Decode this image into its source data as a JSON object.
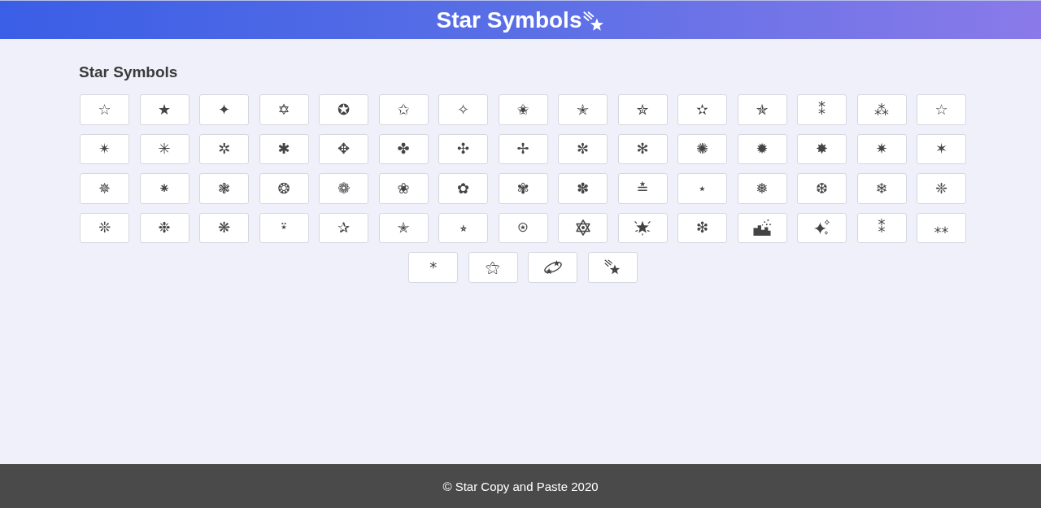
{
  "header": {
    "title": "Star Symbols"
  },
  "section": {
    "heading": "Star Symbols"
  },
  "symbols": [
    {
      "kind": "glyph",
      "text": "☆"
    },
    {
      "kind": "glyph",
      "text": "★"
    },
    {
      "kind": "glyph",
      "text": "✦"
    },
    {
      "kind": "glyph",
      "text": "✡"
    },
    {
      "kind": "glyph",
      "text": "✪"
    },
    {
      "kind": "glyph",
      "text": "✩"
    },
    {
      "kind": "glyph",
      "text": "✧"
    },
    {
      "kind": "glyph",
      "text": "✬"
    },
    {
      "kind": "glyph",
      "text": "✭"
    },
    {
      "kind": "glyph",
      "text": "✮"
    },
    {
      "kind": "glyph",
      "text": "✫"
    },
    {
      "kind": "glyph",
      "text": "✯"
    },
    {
      "kind": "glyph",
      "text": "⁑"
    },
    {
      "kind": "glyph",
      "text": "⁂"
    },
    {
      "kind": "glyph",
      "text": "☆"
    },
    {
      "kind": "glyph",
      "text": "✴"
    },
    {
      "kind": "glyph",
      "text": "✳"
    },
    {
      "kind": "glyph",
      "text": "✲"
    },
    {
      "kind": "glyph",
      "text": "✱"
    },
    {
      "kind": "glyph",
      "text": "✥"
    },
    {
      "kind": "glyph",
      "text": "✤"
    },
    {
      "kind": "glyph",
      "text": "✣"
    },
    {
      "kind": "glyph",
      "text": "✢"
    },
    {
      "kind": "glyph",
      "text": "✼"
    },
    {
      "kind": "glyph",
      "text": "✻"
    },
    {
      "kind": "glyph",
      "text": "✺"
    },
    {
      "kind": "glyph",
      "text": "✹"
    },
    {
      "kind": "glyph",
      "text": "✸"
    },
    {
      "kind": "glyph",
      "text": "✷"
    },
    {
      "kind": "glyph",
      "text": "✶"
    },
    {
      "kind": "glyph",
      "text": "✵"
    },
    {
      "kind": "glyph",
      "text": "⁕"
    },
    {
      "kind": "glyph",
      "text": "❃"
    },
    {
      "kind": "glyph",
      "text": "❂"
    },
    {
      "kind": "glyph",
      "text": "❁"
    },
    {
      "kind": "glyph",
      "text": "❀"
    },
    {
      "kind": "glyph",
      "text": "✿"
    },
    {
      "kind": "glyph",
      "text": "✾"
    },
    {
      "kind": "glyph",
      "text": "✽"
    },
    {
      "kind": "glyph",
      "text": "≛"
    },
    {
      "kind": "glyph",
      "text": "⋆"
    },
    {
      "kind": "glyph",
      "text": "❅"
    },
    {
      "kind": "glyph",
      "text": "❆"
    },
    {
      "kind": "glyph",
      "text": "❄"
    },
    {
      "kind": "glyph",
      "text": "❈"
    },
    {
      "kind": "glyph",
      "text": "❊"
    },
    {
      "kind": "glyph",
      "text": "❉"
    },
    {
      "kind": "glyph",
      "text": "❋"
    },
    {
      "kind": "glyph",
      "text": "⍣"
    },
    {
      "kind": "glyph",
      "text": "✰"
    },
    {
      "kind": "glyph",
      "text": "✭"
    },
    {
      "kind": "glyph",
      "text": "⭒"
    },
    {
      "kind": "glyph",
      "text": "⍟"
    },
    {
      "kind": "hexagram"
    },
    {
      "kind": "glowing"
    },
    {
      "kind": "glyph",
      "text": "❇"
    },
    {
      "kind": "night"
    },
    {
      "kind": "sparkles"
    },
    {
      "kind": "glyph",
      "text": "⁑"
    },
    {
      "kind": "glyph",
      "text": "⁎⁎"
    },
    {
      "kind": "glyph",
      "text": "*"
    },
    {
      "kind": "glyph",
      "text": "⚝"
    },
    {
      "kind": "dizzy"
    },
    {
      "kind": "shooting"
    }
  ],
  "footer": {
    "text": "© Star Copy and Paste 2020"
  }
}
